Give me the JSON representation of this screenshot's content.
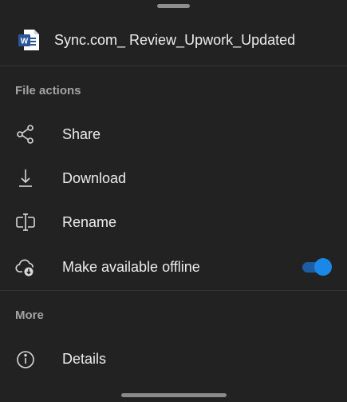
{
  "file": {
    "name": "Sync.com_ Review_Upwork_Updated",
    "icon": "word-document-icon",
    "icon_letter": "W"
  },
  "sections": {
    "file_actions": {
      "title": "File actions",
      "items": [
        {
          "label": "Share",
          "icon": "share-icon"
        },
        {
          "label": "Download",
          "icon": "download-icon"
        },
        {
          "label": "Rename",
          "icon": "rename-icon"
        },
        {
          "label": "Make available offline",
          "icon": "offline-cloud-icon",
          "toggle_on": true
        }
      ]
    },
    "more": {
      "title": "More",
      "items": [
        {
          "label": "Details",
          "icon": "info-icon"
        }
      ]
    }
  },
  "colors": {
    "background": "#222222",
    "accent": "#1b87e8",
    "word_blue": "#2b579a"
  }
}
